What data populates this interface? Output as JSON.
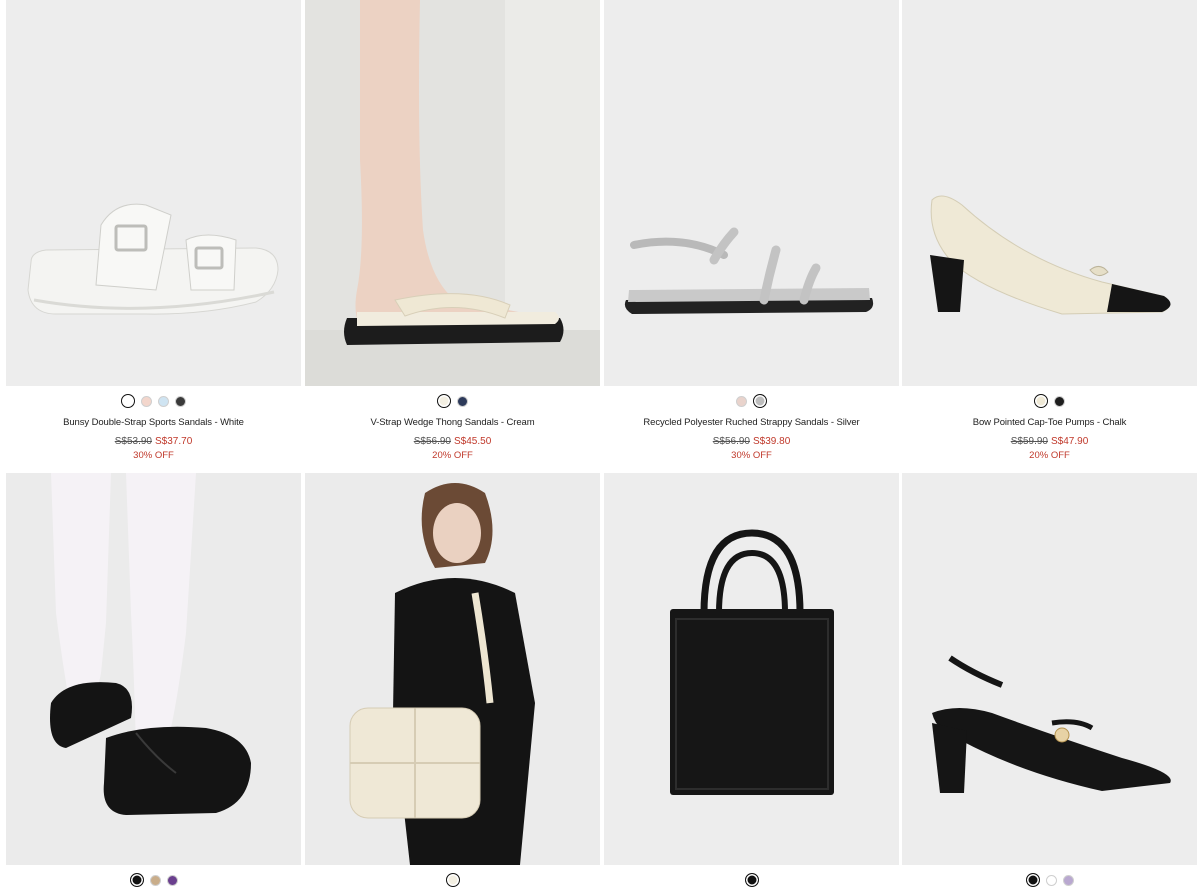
{
  "products": [
    {
      "name": "Bunsy Double-Strap Sports Sandals - White",
      "old_price": "S$53.90",
      "new_price": "S$37.70",
      "discount": "30% OFF",
      "swatches": [
        "#ffffff",
        "#f3d6cc",
        "#cfe4f2",
        "#3a3a3a"
      ],
      "selected_swatch": 0,
      "image": "white-platform-sandal"
    },
    {
      "name": "V-Strap Wedge Thong Sandals - Cream",
      "old_price": "S$56.90",
      "new_price": "S$45.50",
      "discount": "20% OFF",
      "swatches": [
        "#f3efe2",
        "#2d3a5a"
      ],
      "selected_swatch": 0,
      "image": "cream-thong-sandal"
    },
    {
      "name": "Recycled Polyester Ruched Strappy Sandals - Silver",
      "old_price": "S$56.90",
      "new_price": "S$39.80",
      "discount": "30% OFF",
      "swatches": [
        "#e9d3cc",
        "#bdbdbd"
      ],
      "selected_swatch": 1,
      "image": "silver-strappy-sandal"
    },
    {
      "name": "Bow Pointed Cap-Toe Pumps - Chalk",
      "old_price": "S$59.90",
      "new_price": "S$47.90",
      "discount": "20% OFF",
      "swatches": [
        "#efe9d6",
        "#1e1e1e"
      ],
      "selected_swatch": 0,
      "image": "chalk-cap-toe-pump"
    },
    {
      "swatches": [
        "#111111",
        "#c9ad8a",
        "#6a3f8e"
      ],
      "selected_swatch": 0,
      "image": "black-chunky-sandal"
    },
    {
      "swatches": [
        "#f3efe2"
      ],
      "selected_swatch": 0,
      "image": "cream-puffer-bag"
    },
    {
      "swatches": [
        "#111111"
      ],
      "selected_swatch": 0,
      "image": "black-tote-bag"
    },
    {
      "swatches": [
        "#111111",
        "#ffffff",
        "#b9a8d0"
      ],
      "selected_swatch": 0,
      "image": "black-slingback-pump"
    }
  ]
}
